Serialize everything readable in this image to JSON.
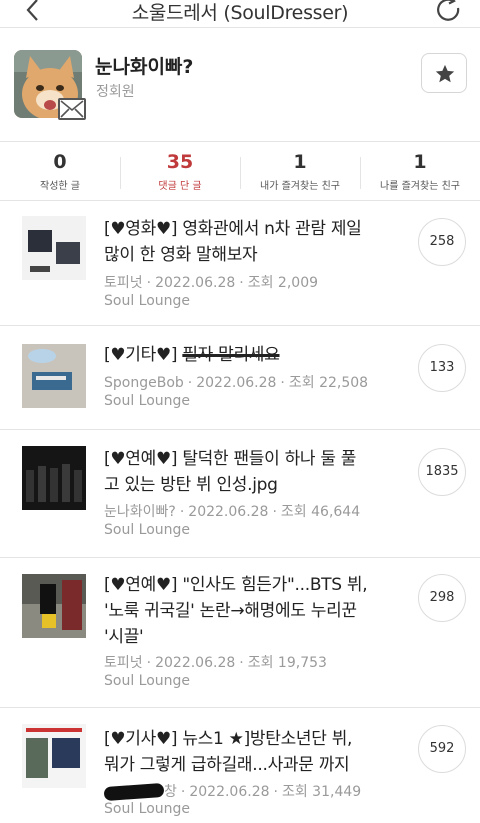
{
  "header": {
    "title": "소울드레서 (SoulDresser)"
  },
  "profile": {
    "nickname": "눈나화이빠?",
    "grade": "정회원"
  },
  "stats": [
    {
      "count": "0",
      "label": "작성한 글"
    },
    {
      "count": "35",
      "label": "댓글 단 글"
    },
    {
      "count": "1",
      "label": "내가 즐겨찾는 친구"
    },
    {
      "count": "1",
      "label": "나를 즐겨찾는 친구"
    }
  ],
  "posts": [
    {
      "line1": "[♥영화♥] 영화관에서 n차 관람 제일",
      "line2": "많이 한 영화 말해보자",
      "author": "토피넛",
      "date": "2022.06.28",
      "views": "조회 2,009",
      "board": "Soul Lounge",
      "comments": "258"
    },
    {
      "line1_prefix": "[♥기타♥] ",
      "line1_struck": "필자 말리세요",
      "author": "SpongeBob",
      "date": "2022.06.28",
      "views": "조회 22,508",
      "board": "Soul Lounge",
      "comments": "133"
    },
    {
      "line1": "[♥연예♥] 탈덕한 팬들이 하나 둘 풀",
      "line2": "고 있는 방탄 뷔 인성.jpg",
      "author": "눈나화이빠?",
      "date": "2022.06.28",
      "views": "조회 46,644",
      "board": "Soul Lounge",
      "comments": "1835"
    },
    {
      "line1": "[♥연예♥] \"인사도 힘든가\"...BTS 뷔,",
      "line2": "'노룩 귀국길' 논란→해명에도 누리꾼",
      "line3": "'시끌'",
      "author": "토피넛",
      "date": "2022.06.28",
      "views": "조회 19,753",
      "board": "Soul Lounge",
      "comments": "298"
    },
    {
      "line1": "[♥기사♥] 뉴스1 ★]방탄소년단 뷔,",
      "line2": "뭐가 그렇게 급하길래...사과문 까지",
      "author_suffix": "창",
      "date": "2022.06.28",
      "views": "조회 31,449",
      "board": "Soul Lounge",
      "comments": "592"
    }
  ]
}
